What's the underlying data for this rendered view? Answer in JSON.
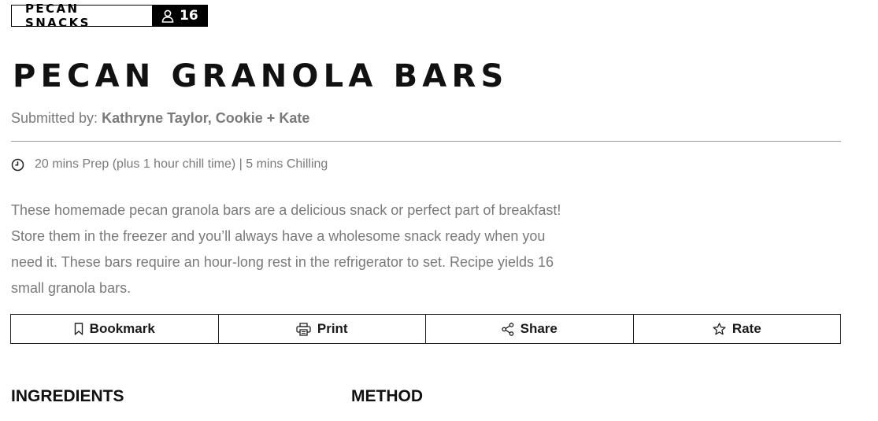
{
  "tag": {
    "category": "PECAN SNACKS",
    "count": "16",
    "count_icon": "person-icon"
  },
  "title": "PECAN GRANOLA BARS",
  "submitted": {
    "prefix": "Submitted by:",
    "author": "Kathryne Taylor, Cookie + Kate"
  },
  "timing": {
    "icon": "clock-icon",
    "text": "20 mins Prep (plus 1 hour chill time) | 5 mins Chilling"
  },
  "description": "These homemade pecan granola bars are a delicious snack or perfect part of breakfast! Store them in the freezer and you’ll always have a wholesome snack ready when you need it. These bars require an hour-long rest in the refrigerator to set. Recipe yields 16 small granola bars.",
  "actions": [
    {
      "label": "Bookmark",
      "icon": "bookmark-icon"
    },
    {
      "label": "Print",
      "icon": "printer-icon"
    },
    {
      "label": "Share",
      "icon": "share-icon"
    },
    {
      "label": "Rate",
      "icon": "star-icon"
    }
  ],
  "sections": {
    "ingredients": "INGREDIENTS",
    "method": "METHOD"
  }
}
